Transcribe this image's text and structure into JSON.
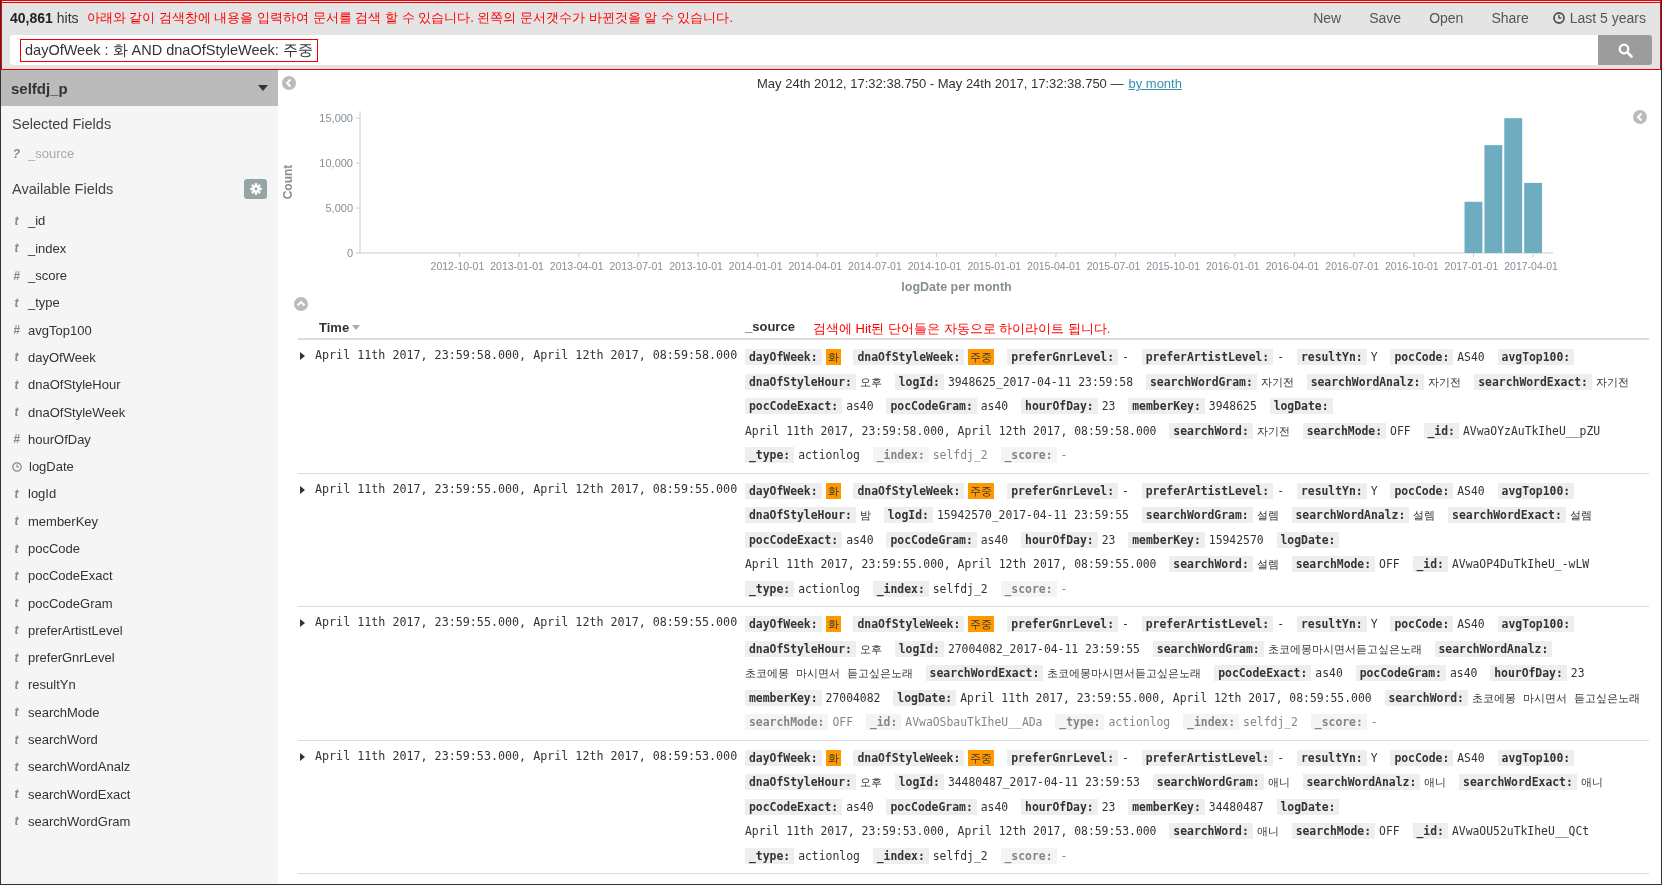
{
  "header": {
    "hits_count": "40,861",
    "hits_label": "hits",
    "annotation": "아래와 같이 검색창에 내용을 입력하여 문서를 검색 할 수 있습니다. 왼쪽의 문서갯수가 바뀐것을 알 수 있습니다.",
    "menu": [
      "New",
      "Save",
      "Open",
      "Share"
    ],
    "time_range": "Last 5 years"
  },
  "search": {
    "value": "dayOfWeek : 화 AND dnaOfStyleWeek: 주중"
  },
  "sidebar": {
    "index_pattern": "selfdj_p",
    "selected_title": "Selected Fields",
    "selected_fields": [
      {
        "kind": "unknown",
        "symbol": "?",
        "name": "_source"
      }
    ],
    "available_title": "Available Fields",
    "available_fields": [
      {
        "kind": "string",
        "symbol": "t",
        "name": "_id"
      },
      {
        "kind": "string",
        "symbol": "t",
        "name": "_index"
      },
      {
        "kind": "number",
        "symbol": "#",
        "name": "_score"
      },
      {
        "kind": "string",
        "symbol": "t",
        "name": "_type"
      },
      {
        "kind": "number",
        "symbol": "#",
        "name": "avgTop100"
      },
      {
        "kind": "string",
        "symbol": "t",
        "name": "dayOfWeek"
      },
      {
        "kind": "string",
        "symbol": "t",
        "name": "dnaOfStyleHour"
      },
      {
        "kind": "string",
        "symbol": "t",
        "name": "dnaOfStyleWeek"
      },
      {
        "kind": "number",
        "symbol": "#",
        "name": "hourOfDay"
      },
      {
        "kind": "date",
        "name": "logDate"
      },
      {
        "kind": "string",
        "symbol": "t",
        "name": "logId"
      },
      {
        "kind": "string",
        "symbol": "t",
        "name": "memberKey"
      },
      {
        "kind": "string",
        "symbol": "t",
        "name": "pocCode"
      },
      {
        "kind": "string",
        "symbol": "t",
        "name": "pocCodeExact"
      },
      {
        "kind": "string",
        "symbol": "t",
        "name": "pocCodeGram"
      },
      {
        "kind": "string",
        "symbol": "t",
        "name": "preferArtistLevel"
      },
      {
        "kind": "string",
        "symbol": "t",
        "name": "preferGnrLevel"
      },
      {
        "kind": "string",
        "symbol": "t",
        "name": "resultYn"
      },
      {
        "kind": "string",
        "symbol": "t",
        "name": "searchMode"
      },
      {
        "kind": "string",
        "symbol": "t",
        "name": "searchWord"
      },
      {
        "kind": "string",
        "symbol": "t",
        "name": "searchWordAnalz"
      },
      {
        "kind": "string",
        "symbol": "t",
        "name": "searchWordExact"
      },
      {
        "kind": "string",
        "symbol": "t",
        "name": "searchWordGram"
      }
    ]
  },
  "histogram": {
    "range": "May 24th 2012, 17:32:38.750 - May 24th 2017, 17:32:38.750 —",
    "interval_link": "by month",
    "chart_data": {
      "type": "bar",
      "xlabel": "logDate per month",
      "ylabel": "Count",
      "x": [
        "2017-01-01",
        "2017-02-01",
        "2017-03-01",
        "2017-04-01"
      ],
      "series": [
        {
          "color": "#6eadc1",
          "values": [
            5700,
            12000,
            15000,
            7800
          ]
        }
      ],
      "xlim": [
        "2012-05-01",
        "2017-05-01"
      ],
      "ylim": [
        0,
        15800
      ],
      "xticks": [
        "2012-10-01",
        "2013-01-01",
        "2013-04-01",
        "2013-07-01",
        "2013-10-01",
        "2014-01-01",
        "2014-04-01",
        "2014-07-01",
        "2014-10-01",
        "2015-01-01",
        "2015-04-01",
        "2015-07-01",
        "2015-10-01",
        "2016-01-01",
        "2016-04-01",
        "2016-07-01",
        "2016-10-01",
        "2017-01-01",
        "2017-04-01"
      ],
      "yticks": [
        {
          "value": 0,
          "label": "0"
        },
        {
          "value": 5000,
          "label": "5,000"
        },
        {
          "value": 10000,
          "label": "10,000"
        },
        {
          "value": 15000,
          "label": "15,000"
        }
      ]
    }
  },
  "table": {
    "columns": [
      {
        "label": "Time",
        "sorted": true
      },
      {
        "label": "_source",
        "sorted": false
      }
    ],
    "annotation": "검색에 Hit된 단어들은 자동으로 하이라이트 됩니다.",
    "rows": [
      {
        "time": "April 11th 2017, 23:59:58.000, April 12th 2017, 08:59:58.000",
        "fields": [
          {
            "key": "dayOfWeek:",
            "value": "화",
            "highlight": true
          },
          {
            "key": "dnaOfStyleWeek:",
            "value": "주중",
            "highlight": true
          },
          {
            "key": "preferGnrLevel:",
            "value": "-",
            "highlight": false
          },
          {
            "key": "preferArtistLevel:",
            "value": "-",
            "highlight": false
          },
          {
            "key": "resultYn:",
            "value": "Y",
            "highlight": false
          },
          {
            "key": "pocCode:",
            "value": "AS40",
            "highlight": false
          },
          {
            "key": "avgTop100:",
            "highlight": false
          },
          {
            "key": "dnaOfStyleHour:",
            "value": "오후",
            "highlight": false
          },
          {
            "key": "logId:",
            "value": "3948625_2017-04-11 23:59:58",
            "highlight": false
          },
          {
            "key": "searchWordGram:",
            "value": "자기전",
            "highlight": false
          },
          {
            "key": "searchWordAnalz:",
            "value": "자기전",
            "highlight": false
          },
          {
            "key": "searchWordExact:",
            "value": "자기전",
            "highlight": false
          },
          {
            "key": "pocCodeExact:",
            "value": "as40",
            "highlight": false
          },
          {
            "key": "pocCodeGram:",
            "value": "as40",
            "highlight": false
          },
          {
            "key": "hourOfDay:",
            "value": "23",
            "highlight": false
          },
          {
            "key": "memberKey:",
            "value": "3948625",
            "highlight": false
          },
          {
            "key": "logDate:",
            "value": "April 11th 2017, 23:59:58.000, April 12th 2017, 08:59:58.000",
            "highlight": false
          },
          {
            "key": "searchWord:",
            "value": "자기전",
            "highlight": false
          },
          {
            "key": "searchMode:",
            "value": "OFF",
            "highlight": false
          },
          {
            "key": "_id:",
            "value": "AVwaOYzAuTkIheU__pZU",
            "highlight": false
          },
          {
            "key": "_type:",
            "value": "actionlog",
            "highlight": false
          }
        ],
        "faded_fields": [
          {
            "key": "_index:",
            "value": "selfdj_2"
          },
          {
            "key": "_score:",
            "value": "-"
          }
        ]
      },
      {
        "time": "April 11th 2017, 23:59:55.000, April 12th 2017, 08:59:55.000",
        "fields": [
          {
            "key": "dayOfWeek:",
            "value": "화",
            "highlight": true
          },
          {
            "key": "dnaOfStyleWeek:",
            "value": "주중",
            "highlight": true
          },
          {
            "key": "preferGnrLevel:",
            "value": "-",
            "highlight": false
          },
          {
            "key": "preferArtistLevel:",
            "value": "-",
            "highlight": false
          },
          {
            "key": "resultYn:",
            "value": "Y",
            "highlight": false
          },
          {
            "key": "pocCode:",
            "value": "AS40",
            "highlight": false
          },
          {
            "key": "avgTop100:",
            "highlight": false
          },
          {
            "key": "dnaOfStyleHour:",
            "value": "밤",
            "highlight": false
          },
          {
            "key": "logId:",
            "value": "15942570_2017-04-11 23:59:55",
            "highlight": false
          },
          {
            "key": "searchWordGram:",
            "value": "설렘",
            "highlight": false
          },
          {
            "key": "searchWordAnalz:",
            "value": "설렘",
            "highlight": false
          },
          {
            "key": "searchWordExact:",
            "value": "설렘",
            "highlight": false
          },
          {
            "key": "pocCodeExact:",
            "value": "as40",
            "highlight": false
          },
          {
            "key": "pocCodeGram:",
            "value": "as40",
            "highlight": false
          },
          {
            "key": "hourOfDay:",
            "value": "23",
            "highlight": false
          },
          {
            "key": "memberKey:",
            "value": "15942570",
            "highlight": false
          },
          {
            "key": "logDate:",
            "value": "April 11th 2017, 23:59:55.000, April 12th 2017, 08:59:55.000",
            "highlight": false
          },
          {
            "key": "searchWord:",
            "value": "설렘",
            "highlight": false
          },
          {
            "key": "searchMode:",
            "value": "OFF",
            "highlight": false
          },
          {
            "key": "_id:",
            "value": "AVwaOP4DuTkIheU_-wLW",
            "highlight": false
          },
          {
            "key": "_type:",
            "value": "actionlog",
            "highlight": false
          },
          {
            "key": "_index:",
            "value": "selfdj_2",
            "highlight": false
          }
        ],
        "faded_fields": [
          {
            "key": "_score:",
            "value": "-"
          }
        ]
      },
      {
        "time": "April 11th 2017, 23:59:55.000, April 12th 2017, 08:59:55.000",
        "fields": [
          {
            "key": "dayOfWeek:",
            "value": "화",
            "highlight": true
          },
          {
            "key": "dnaOfStyleWeek:",
            "value": "주중",
            "highlight": true
          },
          {
            "key": "preferGnrLevel:",
            "value": "-",
            "highlight": false
          },
          {
            "key": "preferArtistLevel:",
            "value": "-",
            "highlight": false
          },
          {
            "key": "resultYn:",
            "value": "Y",
            "highlight": false
          },
          {
            "key": "pocCode:",
            "value": "AS40",
            "highlight": false
          },
          {
            "key": "avgTop100:",
            "highlight": false
          },
          {
            "key": "dnaOfStyleHour:",
            "value": "오후",
            "highlight": false
          },
          {
            "key": "logId:",
            "value": "27004082_2017-04-11 23:59:55",
            "highlight": false
          },
          {
            "key": "searchWordGram:",
            "value": "초코에몽마시면서듣고싶은노래",
            "highlight": false
          },
          {
            "key": "searchWordAnalz:",
            "value": "초코에몽 마시면서 듣고싶은노래",
            "highlight": false
          },
          {
            "key": "searchWordExact:",
            "value": "초코에몽마시면서듣고싶은노래",
            "highlight": false
          },
          {
            "key": "pocCodeExact:",
            "value": "as40",
            "highlight": false
          },
          {
            "key": "pocCodeGram:",
            "value": "as40",
            "highlight": false
          },
          {
            "key": "hourOfDay:",
            "value": "23",
            "highlight": false
          },
          {
            "key": "memberKey:",
            "value": "27004082",
            "highlight": false
          },
          {
            "key": "logDate:",
            "value": "April 11th 2017, 23:59:55.000, April 12th 2017, 08:59:55.000",
            "highlight": false
          },
          {
            "key": "searchWord:",
            "value": "초코에몽 마시면서 듣고싶은노래",
            "highlight": false
          }
        ],
        "faded_fields": [
          {
            "key": "searchMode:",
            "value": "OFF"
          },
          {
            "key": "_id:",
            "value": "AVwaOSbauTkIheU__ADa"
          },
          {
            "key": "_type:",
            "value": "actionlog"
          },
          {
            "key": "_index:",
            "value": "selfdj_2"
          },
          {
            "key": "_score:",
            "value": "-"
          }
        ]
      },
      {
        "time": "April 11th 2017, 23:59:53.000, April 12th 2017, 08:59:53.000",
        "fields": [
          {
            "key": "dayOfWeek:",
            "value": "화",
            "highlight": true
          },
          {
            "key": "dnaOfStyleWeek:",
            "value": "주중",
            "highlight": true
          },
          {
            "key": "preferGnrLevel:",
            "value": "-",
            "highlight": false
          },
          {
            "key": "preferArtistLevel:",
            "value": "-",
            "highlight": false
          },
          {
            "key": "resultYn:",
            "value": "Y",
            "highlight": false
          },
          {
            "key": "pocCode:",
            "value": "AS40",
            "highlight": false
          },
          {
            "key": "avgTop100:",
            "highlight": false
          },
          {
            "key": "dnaOfStyleHour:",
            "value": "오후",
            "highlight": false
          },
          {
            "key": "logId:",
            "value": "34480487_2017-04-11 23:59:53",
            "highlight": false
          },
          {
            "key": "searchWordGram:",
            "value": "애니",
            "highlight": false
          },
          {
            "key": "searchWordAnalz:",
            "value": "애니",
            "highlight": false
          },
          {
            "key": "searchWordExact:",
            "value": "애니",
            "highlight": false
          },
          {
            "key": "pocCodeExact:",
            "value": "as40",
            "highlight": false
          },
          {
            "key": "pocCodeGram:",
            "value": "as40",
            "highlight": false
          },
          {
            "key": "hourOfDay:",
            "value": "23",
            "highlight": false
          },
          {
            "key": "memberKey:",
            "value": "34480487",
            "highlight": false
          },
          {
            "key": "logDate:",
            "value": "April 11th 2017, 23:59:53.000, April 12th 2017, 08:59:53.000",
            "highlight": false
          },
          {
            "key": "searchWord:",
            "value": "애니",
            "highlight": false
          },
          {
            "key": "searchMode:",
            "value": "OFF",
            "highlight": false
          },
          {
            "key": "_id:",
            "value": "AVwaOU52uTkIheU__QCt",
            "highlight": false
          },
          {
            "key": "_type:",
            "value": "actionlog",
            "highlight": false
          },
          {
            "key": "_index:",
            "value": "selfdj_2",
            "highlight": false
          }
        ],
        "faded_fields": [
          {
            "key": "_score:",
            "value": "-"
          }
        ]
      }
    ]
  }
}
